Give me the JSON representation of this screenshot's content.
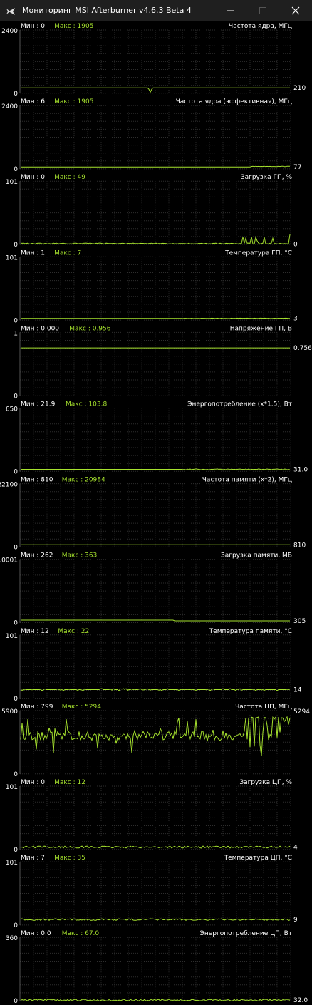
{
  "window": {
    "title": "Мониторинг MSI Afterburner v4.6.3 Beta 4",
    "icons": {
      "app": "afterburner-plane-icon",
      "minimize": "minimize-icon",
      "maximize": "maximize-icon",
      "close": "close-icon"
    }
  },
  "colors": {
    "line": "#a6e22e",
    "grid": "#2e2e2e",
    "text": "#ffffff",
    "axis_text": "#cccccc",
    "background": "#000000"
  },
  "chart_data": [
    {
      "type": "line",
      "title": "Частота ядра, МГц",
      "min_label": "Мин : 0",
      "max_label": "Макс : 1905",
      "ymax_label": "2400",
      "ymin_label": "0",
      "current_label": "210",
      "ylim": [
        0,
        2400
      ],
      "current": 210,
      "pattern": "flat-dip",
      "noise": 0
    },
    {
      "type": "line",
      "title": "Частота ядра (эффективная), МГц",
      "min_label": "Мин : 6",
      "max_label": "Макс : 1905",
      "ymax_label": "2400",
      "ymin_label": "0",
      "current_label": "77",
      "ylim": [
        0,
        2400
      ],
      "current": 77,
      "pattern": "flat-rise",
      "noise": 0.3
    },
    {
      "type": "line",
      "title": "Загрузка ГП, %",
      "min_label": "Мин : 0",
      "max_label": "Макс : 49",
      "ymax_label": "101",
      "ymin_label": "0",
      "current_label": "0",
      "ylim": [
        0,
        101
      ],
      "current": 1,
      "pattern": "noisy-spikes-end",
      "noise": 1.2
    },
    {
      "type": "line",
      "title": "Температура ГП, °С",
      "min_label": "Мин : 1",
      "max_label": "Макс : 7",
      "ymax_label": "101",
      "ymin_label": "0",
      "current_label": "3",
      "ylim": [
        0,
        101
      ],
      "current": 3,
      "pattern": "flat-noisy-end",
      "noise": 0.3
    },
    {
      "type": "line",
      "title": "Напряжение ГП, В",
      "min_label": "Мин : 0.000",
      "max_label": "Макс : 0.956",
      "ymax_label": "1",
      "ymin_label": "0",
      "current_label": "0.756",
      "ylim": [
        0,
        1
      ],
      "current": 0.756,
      "pattern": "flat",
      "noise": 0
    },
    {
      "type": "line",
      "title": "Энергопотребление (х*1.5), Вт",
      "min_label": "Мин : 21.9",
      "max_label": "Макс : 103.8",
      "ymax_label": "650",
      "ymin_label": "0",
      "current_label": "31.0",
      "ylim": [
        0,
        650
      ],
      "current": 21.9,
      "pattern": "flat-noisy-end",
      "noise": 0.6
    },
    {
      "type": "line",
      "title": "Частота памяти (х*2), МГц",
      "min_label": "Мин : 810",
      "max_label": "Макс : 20984",
      "ymax_label": "22100",
      "ymin_label": "0",
      "current_label": "810",
      "ylim": [
        0,
        22100
      ],
      "current": 810,
      "pattern": "flat",
      "noise": 0
    },
    {
      "type": "line",
      "title": "Загрузка памяти, МБ",
      "min_label": "Мин : 262",
      "max_label": "Макс : 363",
      "ymax_label": "10001",
      "ymin_label": "0",
      "current_label": "305",
      "ylim": [
        0,
        10001
      ],
      "current": 305,
      "pattern": "step-down",
      "noise": 0
    },
    {
      "type": "line",
      "title": "Температура памяти, °С",
      "min_label": "Мин : 12",
      "max_label": "Макс : 22",
      "ymax_label": "101",
      "ymin_label": "0",
      "current_label": "14",
      "ylim": [
        0,
        101
      ],
      "current": 14,
      "pattern": "step-wobble",
      "noise": 0.6
    },
    {
      "type": "line",
      "title": "Частота ЦП, МГц",
      "min_label": "Мин : 799",
      "max_label": "Макс : 5294",
      "ymax_label": "5900",
      "ymin_label": "0",
      "current_label": "5294",
      "ylim": [
        0,
        5900
      ],
      "current": 5294,
      "pattern": "cpu-freq",
      "noise": 0
    },
    {
      "type": "line",
      "title": "Загрузка ЦП, %",
      "min_label": "Мин : 0",
      "max_label": "Макс : 12",
      "ymax_label": "101",
      "ymin_label": "0",
      "current_label": "4",
      "ylim": [
        0,
        101
      ],
      "current": 4,
      "pattern": "noisy",
      "noise": 1.4
    },
    {
      "type": "line",
      "title": "Температура ЦП, °С",
      "min_label": "Мин : 7",
      "max_label": "Макс : 35",
      "ymax_label": "101",
      "ymin_label": "0",
      "current_label": "9",
      "ylim": [
        0,
        101
      ],
      "current": 9,
      "pattern": "noisy",
      "noise": 1.2
    },
    {
      "type": "line",
      "title": "Энергопотребление ЦП, Вт",
      "min_label": "Мин : 0.0",
      "max_label": "Макс : 67.0",
      "ymax_label": "360",
      "ymin_label": "0",
      "current_label": "32.0",
      "ylim": [
        0,
        360
      ],
      "current": 4,
      "pattern": "noisy",
      "noise": 1.2
    }
  ]
}
